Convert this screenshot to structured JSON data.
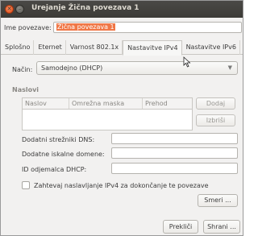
{
  "window": {
    "title": "Urejanje Žična povezava 1",
    "close_glyph": "✕",
    "minimize_glyph": "–"
  },
  "connection_name": {
    "label": "Ime povezave:",
    "value": "Žična povezava 1"
  },
  "tabs": [
    {
      "label": "Splošno"
    },
    {
      "label": "Eternet"
    },
    {
      "label": "Varnost 802.1x"
    },
    {
      "label": "Nastavitve IPv4",
      "active": true
    },
    {
      "label": "Nastavitve IPv6"
    }
  ],
  "method": {
    "label": "Način:",
    "value": "Samodejno (DHCP)"
  },
  "addresses": {
    "section_title": "Naslovi",
    "columns": [
      "Naslov",
      "Omrežna maska",
      "Prehod"
    ],
    "add_label": "Dodaj",
    "remove_label": "Izbriši"
  },
  "fields": {
    "dns_label": "Dodatni strežniki DNS:",
    "search_label": "Dodatne iskalne domene:",
    "dhcp_label": "ID odjemalca DHCP:"
  },
  "require_ipv4": {
    "label": "Zahtevaj naslavljanje IPv4 za dokončanje te povezave"
  },
  "routes_label": "Smeri ...",
  "footer": {
    "cancel_label": "Prekliči",
    "save_label": "Shrani ..."
  },
  "colors": {
    "accent": "#f07746",
    "titlebar": "#3c3b37"
  }
}
